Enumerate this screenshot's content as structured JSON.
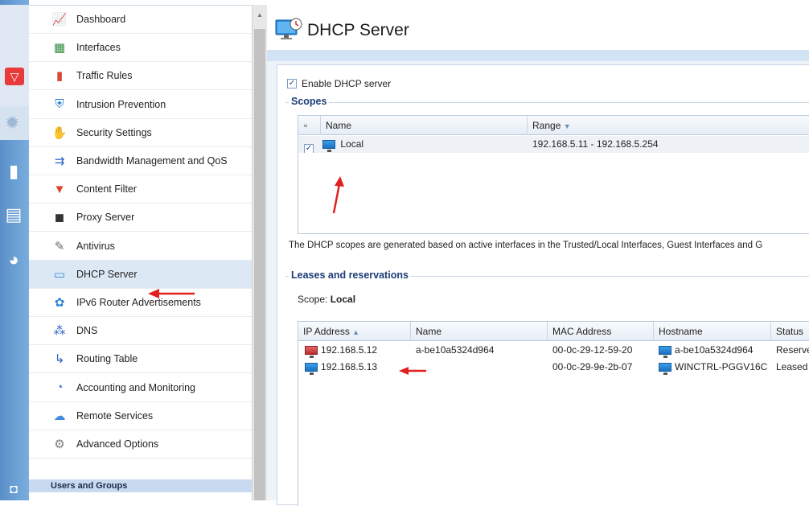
{
  "colors": {
    "accent": "#1c3c78",
    "arrow": "#e02020",
    "nav_active": "#dde8f5",
    "rail": "#5a8fc9"
  },
  "nav": {
    "items": [
      {
        "label": "Dashboard",
        "icon": "dashboard-icon"
      },
      {
        "label": "Interfaces",
        "icon": "interfaces-icon"
      },
      {
        "label": "Traffic Rules",
        "icon": "traffic-rules-icon"
      },
      {
        "label": "Intrusion Prevention",
        "icon": "shield-icon"
      },
      {
        "label": "Security Settings",
        "icon": "hand-stop-icon"
      },
      {
        "label": "Bandwidth Management and QoS",
        "icon": "bandwidth-arrow-icon"
      },
      {
        "label": "Content Filter",
        "icon": "filter-funnel-icon"
      },
      {
        "label": "Proxy Server",
        "icon": "proxy-server-icon"
      },
      {
        "label": "Antivirus",
        "icon": "antivirus-pen-icon"
      },
      {
        "label": "DHCP Server",
        "icon": "dhcp-monitor-icon"
      },
      {
        "label": "IPv6 Router Advertisements",
        "icon": "ipv6-globe-icon"
      },
      {
        "label": "DNS",
        "icon": "dns-network-icon"
      },
      {
        "label": "Routing Table",
        "icon": "routing-table-icon"
      },
      {
        "label": "Accounting and Monitoring",
        "icon": "accounting-icon"
      },
      {
        "label": "Remote Services",
        "icon": "cloud-gear-icon"
      },
      {
        "label": "Advanced Options",
        "icon": "tools-gear-icon"
      }
    ],
    "active": "DHCP Server",
    "group_header": "Users and Groups"
  },
  "page": {
    "title": "DHCP Server"
  },
  "enable": {
    "label": "Enable DHCP server",
    "checked": true
  },
  "scopes": {
    "legend": "Scopes",
    "columns": [
      "Name",
      "Range"
    ],
    "sort_column": "Range",
    "rows": [
      {
        "checked": true,
        "name": "Local",
        "range": "192.168.5.11 - 192.168.5.254"
      }
    ],
    "note": "The DHCP scopes are generated based on active interfaces in the Trusted/Local Interfaces, Guest Interfaces and G"
  },
  "leases": {
    "legend": "Leases and reservations",
    "scope_label": "Scope:",
    "scope_value": "Local",
    "columns": [
      "IP Address",
      "Name",
      "MAC Address",
      "Hostname",
      "Status"
    ],
    "sort_column": "IP Address",
    "rows": [
      {
        "ip": "192.168.5.12",
        "name": "a-be10a5324d964",
        "mac": "00-0c-29-12-59-20",
        "hostname": "a-be10a5324d964",
        "status": "Reserve",
        "ip_icon": "red"
      },
      {
        "ip": "192.168.5.13",
        "name": "",
        "mac": "00-0c-29-9e-2b-07",
        "hostname": "WINCTRL-PGGV16C",
        "status": "Leased",
        "ip_icon": "blue"
      }
    ]
  }
}
